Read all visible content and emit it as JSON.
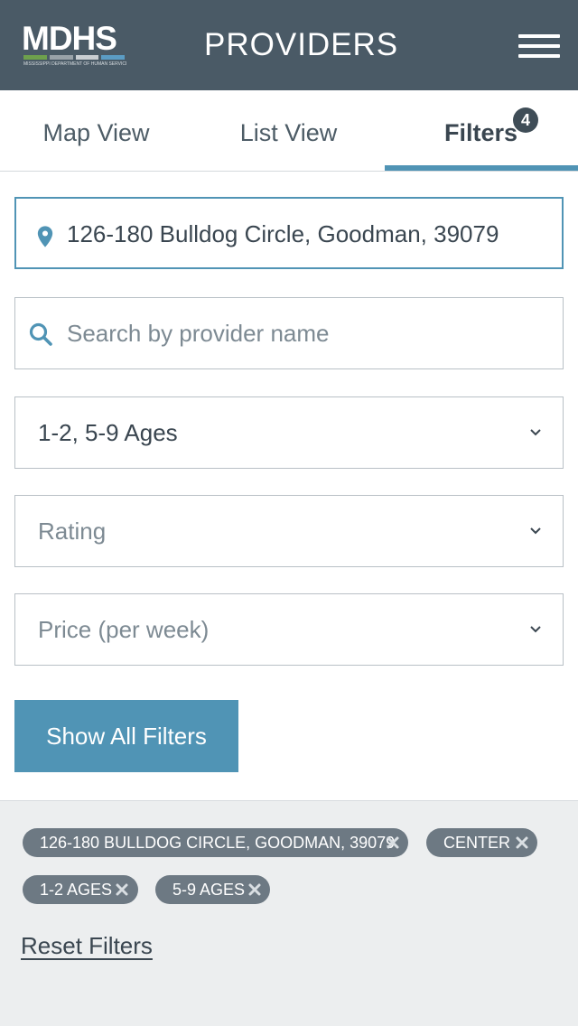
{
  "header": {
    "logo_text": "MDHS",
    "logo_subtitle": "MISSISSIPPI DEPARTMENT OF HUMAN SERVICES",
    "logo_colors": [
      "#6ea04d",
      "#9aa3a9",
      "#c9ced2",
      "#5b9cc4"
    ],
    "title": "PROVIDERS",
    "menu_icon": "hamburger-menu-icon"
  },
  "tabs": [
    {
      "label": "Map View",
      "active": false
    },
    {
      "label": "List View",
      "active": false
    },
    {
      "label": "Filters",
      "active": true,
      "badge": "4"
    }
  ],
  "location": {
    "value": "126-180 Bulldog Circle, Goodman, 39079",
    "icon": "location-pin-icon"
  },
  "search": {
    "placeholder": "Search by provider name",
    "icon": "search-icon"
  },
  "selects": {
    "ages": {
      "value": "1-2, 5-9 Ages"
    },
    "rating": {
      "placeholder": "Rating"
    },
    "price": {
      "placeholder": "Price (per week)"
    }
  },
  "show_all_filters": "Show All Filters",
  "active_filters": [
    "126-180 BULLDOG CIRCLE, GOODMAN, 39079",
    "CENTER",
    "1-2 AGES",
    "5-9 AGES"
  ],
  "reset_filters": "Reset Filters",
  "colors": {
    "header_bg": "#4a5a66",
    "accent": "#5094b5",
    "chip_bg": "#6d7983",
    "chips_area_bg": "#eceeef"
  }
}
